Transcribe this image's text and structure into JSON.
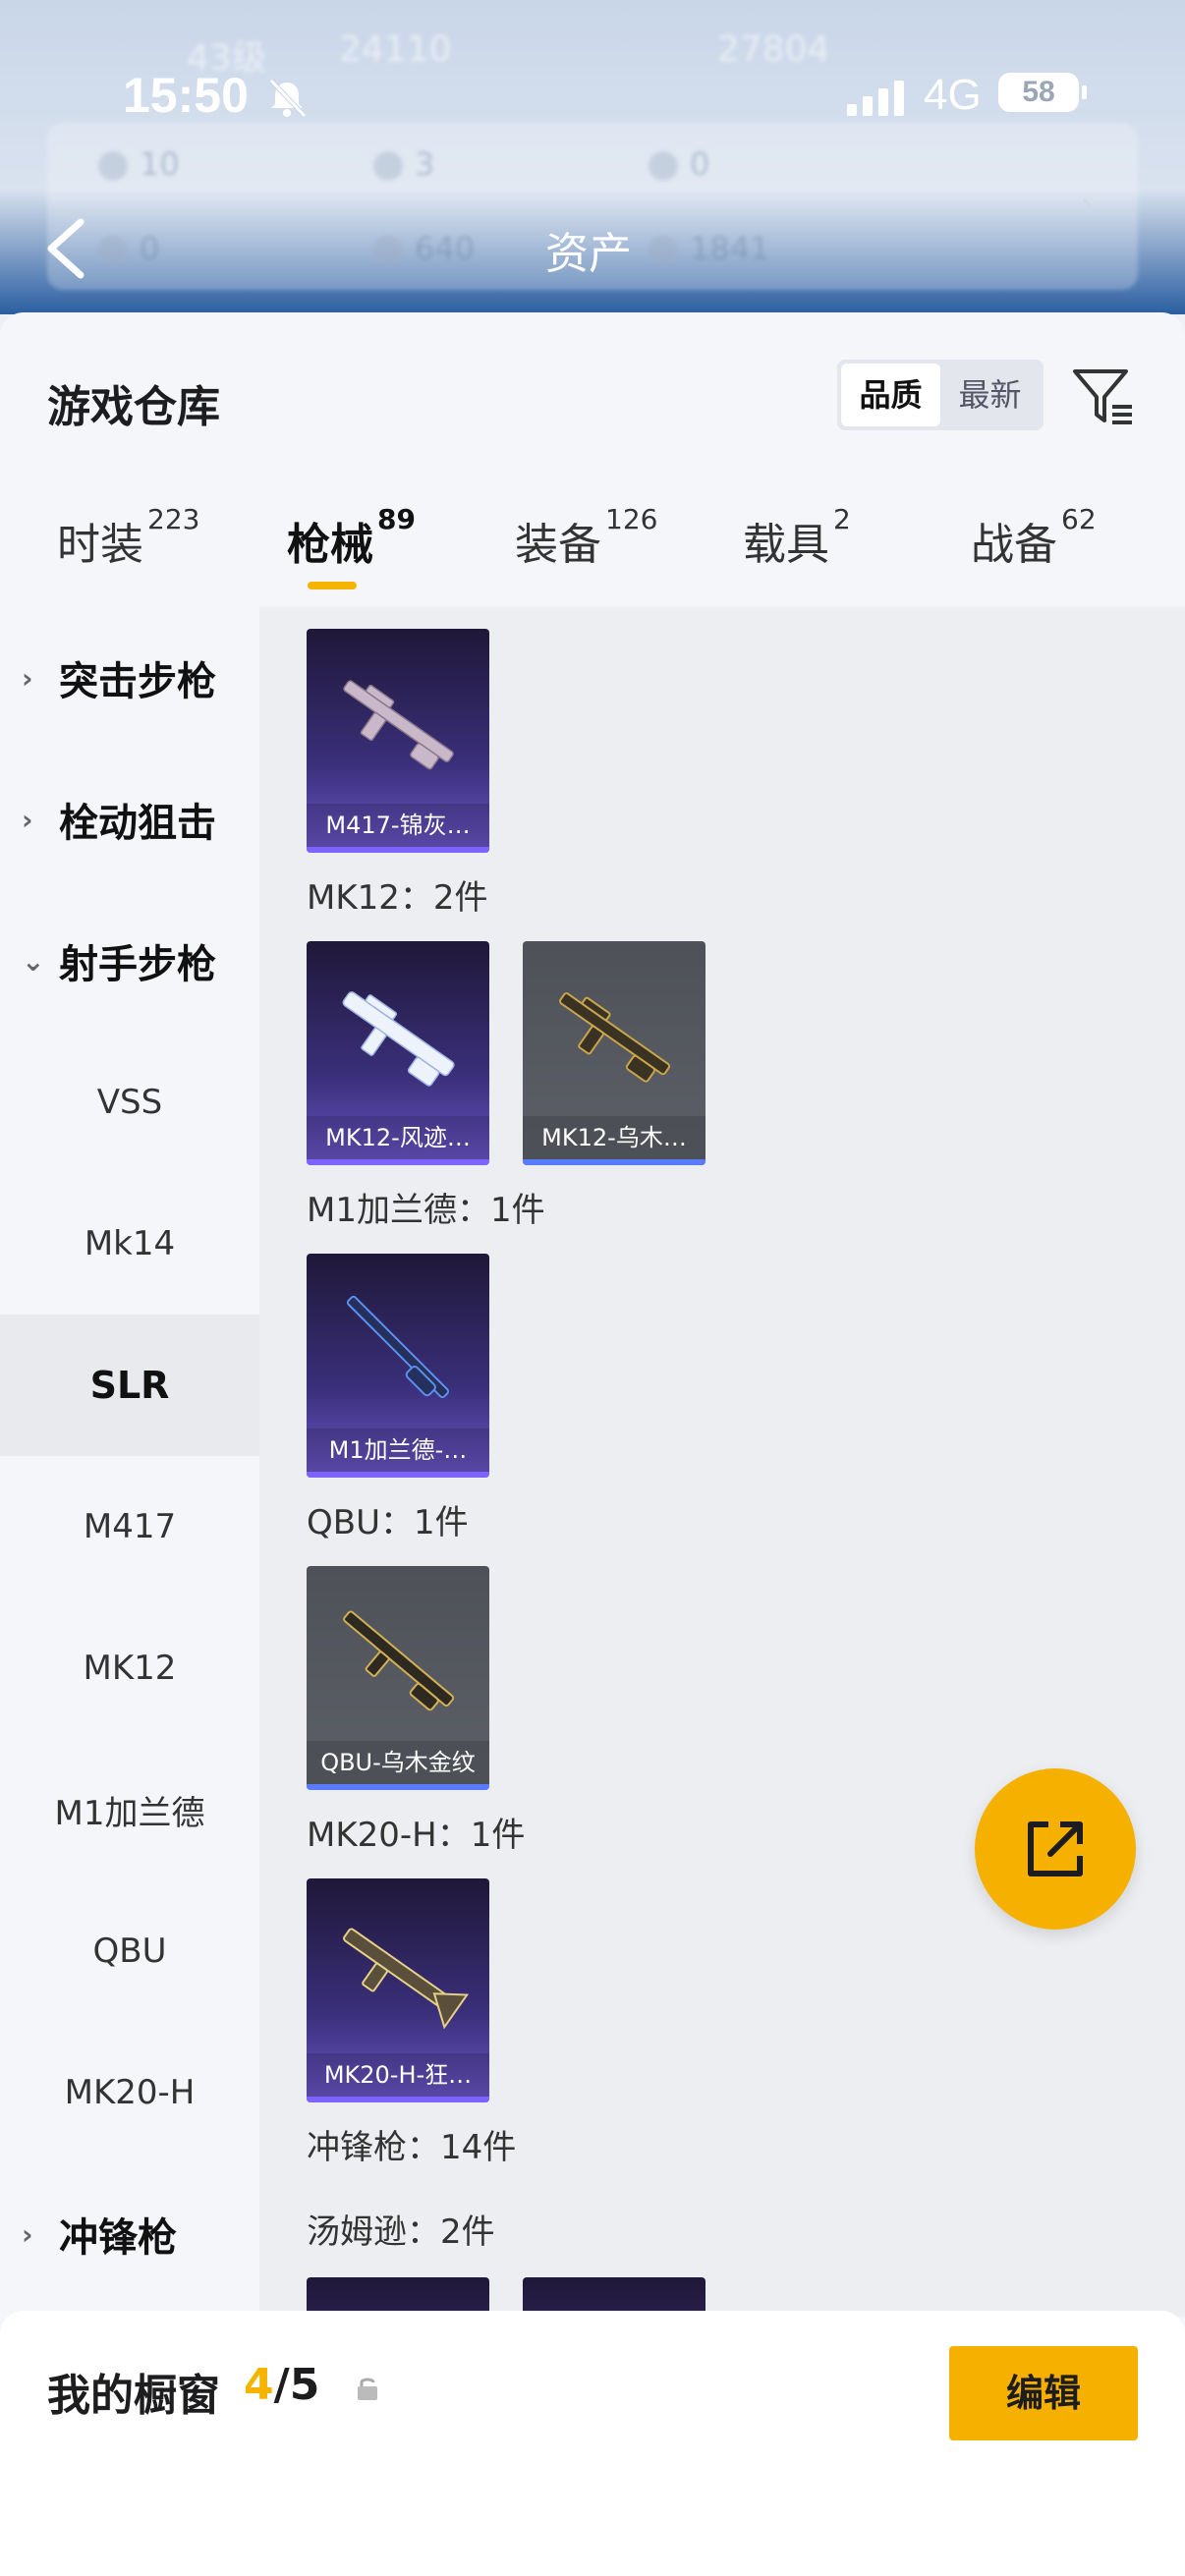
{
  "status_bar": {
    "time": "15:50",
    "network": "4G",
    "battery": "58"
  },
  "background": {
    "level": "43级",
    "coins": "24110",
    "score": "27804",
    "stats": [
      "10",
      "3",
      "0",
      "0",
      "640",
      "1841"
    ],
    "title": "资产"
  },
  "sheet": {
    "title": "游戏仓库",
    "sort_options": [
      "品质",
      "最新"
    ],
    "tabs": [
      {
        "label": "时装",
        "count": "223"
      },
      {
        "label": "枪械",
        "count": "89"
      },
      {
        "label": "装备",
        "count": "126"
      },
      {
        "label": "载具",
        "count": "2"
      },
      {
        "label": "战备",
        "count": "62"
      }
    ]
  },
  "sidebar": {
    "items": [
      {
        "label": "突击步枪",
        "type": "category"
      },
      {
        "label": "栓动狙击",
        "type": "category"
      },
      {
        "label": "射手步枪",
        "type": "category"
      },
      {
        "label": "VSS"
      },
      {
        "label": "Mk14"
      },
      {
        "label": "SLR",
        "selected": true
      },
      {
        "label": "M417"
      },
      {
        "label": "MK12"
      },
      {
        "label": "M1加兰德"
      },
      {
        "label": "QBU"
      },
      {
        "label": "MK20-H"
      },
      {
        "label": "冲锋枪",
        "type": "category"
      }
    ]
  },
  "content": {
    "groups": [
      {
        "label": "MK12：2件"
      },
      {
        "label": "M1加兰德：1件"
      },
      {
        "label": "QBU：1件"
      },
      {
        "label": "MK20-H：1件"
      },
      {
        "label": "冲锋枪：14件"
      },
      {
        "label": "汤姆逊：2件"
      }
    ],
    "cards": [
      {
        "label": "M417-锦灰…",
        "style": "purple"
      },
      {
        "label": "MK12-风迹…",
        "style": "purple"
      },
      {
        "label": "MK12-乌木…",
        "style": "grey"
      },
      {
        "label": "M1加兰德-…",
        "style": "purple"
      },
      {
        "label": "QBU-乌木金纹",
        "style": "grey"
      },
      {
        "label": "MK20-H-狂…",
        "style": "purple"
      }
    ]
  },
  "bottom": {
    "title": "我的橱窗",
    "count_current": "4",
    "count_total": "/5",
    "edit_label": "编辑"
  },
  "colors": {
    "accent": "#f5b400",
    "fab": "#f5b000"
  }
}
